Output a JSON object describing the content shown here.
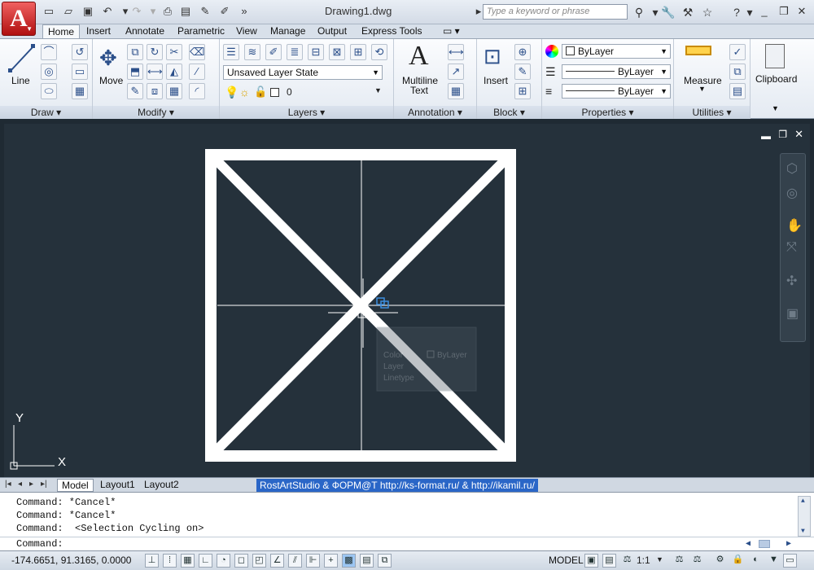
{
  "title_bar": {
    "document_title": "Drawing1.dwg",
    "search_placeholder": "Type a keyword or phrase"
  },
  "tabs": [
    "Home",
    "Insert",
    "Annotate",
    "Parametric",
    "View",
    "Manage",
    "Output",
    "Express Tools"
  ],
  "active_tab": "Home",
  "ribbon": {
    "draw": {
      "title": "Draw",
      "line_label": "Line"
    },
    "modify": {
      "title": "Modify",
      "move_label": "Move"
    },
    "layers": {
      "title": "Layers",
      "layer_state": "Unsaved Layer State",
      "current_layer": "0"
    },
    "annotation": {
      "title": "Annotation",
      "mtext_label_1": "Multiline",
      "mtext_label_2": "Text"
    },
    "block": {
      "title": "Block",
      "insert_label": "Insert"
    },
    "properties": {
      "title": "Properties",
      "color": "ByLayer",
      "linetype": "ByLayer",
      "lineweight": "ByLayer"
    },
    "utilities": {
      "title": "Utilities",
      "measure_label": "Measure"
    },
    "clipboard": {
      "title": "Clipboard"
    }
  },
  "drawing": {
    "ucs_x": "X",
    "ucs_y": "Y",
    "tooltip": {
      "color_label": "Color",
      "color_value": "ByLayer",
      "layer_label": "Layer",
      "linetype_label": "Linetype"
    }
  },
  "layout_tabs": [
    "Model",
    "Layout1",
    "Layout2"
  ],
  "credit": "RostArtStudio & ФОРМ@Т http://ks-format.ru/ & http://ikamil.ru/",
  "command_history": [
    "Command: *Cancel*",
    "Command: *Cancel*",
    "Command:  <Selection Cycling on>"
  ],
  "command_prompt": "Command:",
  "status_bar": {
    "coordinates": "-174.6651, 91.3165, 0.0000",
    "space": "MODEL",
    "scale": "1:1"
  }
}
